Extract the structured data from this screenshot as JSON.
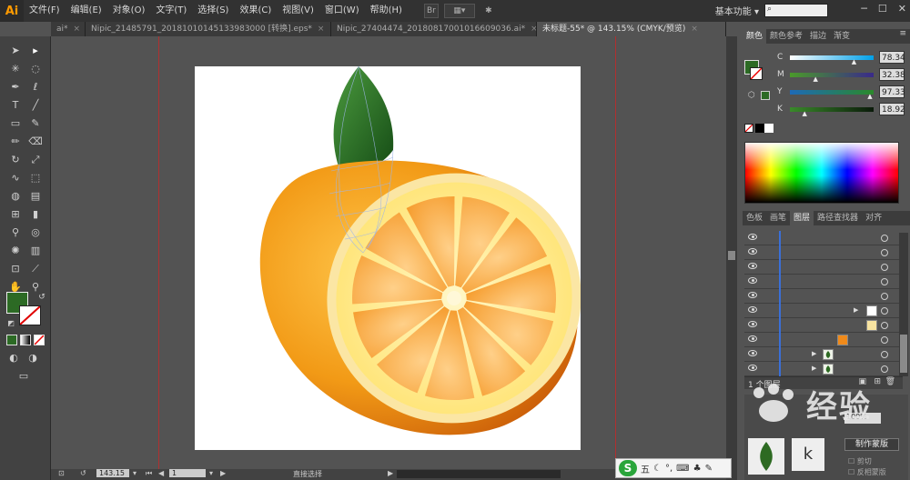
{
  "app": {
    "logo": "Ai",
    "workspace": "基本功能",
    "search_icon": "search-icon"
  },
  "menus": [
    "文件(F)",
    "编辑(E)",
    "对象(O)",
    "文字(T)",
    "选择(S)",
    "效果(C)",
    "视图(V)",
    "窗口(W)",
    "帮助(H)"
  ],
  "tabs": [
    {
      "label": "ai*",
      "active": false
    },
    {
      "label": "Nipic_21485791_20181010145133983000 [转换].eps*",
      "active": false
    },
    {
      "label": "Nipic_27404474_20180817001016609036.ai*",
      "active": false
    },
    {
      "label": "未标题-55* @ 143.15% (CMYK/预览)",
      "active": true
    }
  ],
  "color_panel": {
    "tabs": [
      "颜色",
      "颜色参考",
      "描边",
      "渐变"
    ],
    "channels": [
      {
        "label": "C",
        "value": "78.34",
        "pos": 0.78,
        "from": "#ffffff",
        "to": "#00a0e8"
      },
      {
        "label": "M",
        "value": "32.38",
        "pos": 0.32,
        "from": "#4a9a2a",
        "to": "#3a2a8a"
      },
      {
        "label": "Y",
        "value": "97.33",
        "pos": 0.97,
        "from": "#1e6ab8",
        "to": "#2a8a2a"
      },
      {
        "label": "K",
        "value": "18.92",
        "pos": 0.19,
        "from": "#3a8a2a",
        "to": "#0a1a0a"
      }
    ],
    "fill_color": "#2c6a24"
  },
  "layers_panel": {
    "tabs": [
      "色板",
      "画笔",
      "图层",
      "路径查找器",
      "对齐"
    ],
    "footer": "1 个图层"
  },
  "status": {
    "zoom": "143.15",
    "page": "1",
    "tool": "直接选择"
  },
  "watermark": {
    "text": "经验"
  },
  "ime": {
    "logo": "S",
    "mode": "五"
  },
  "bottom_right": {
    "label1": "制作蒙版",
    "label2": "剪切",
    "label3": "反相蒙版"
  }
}
